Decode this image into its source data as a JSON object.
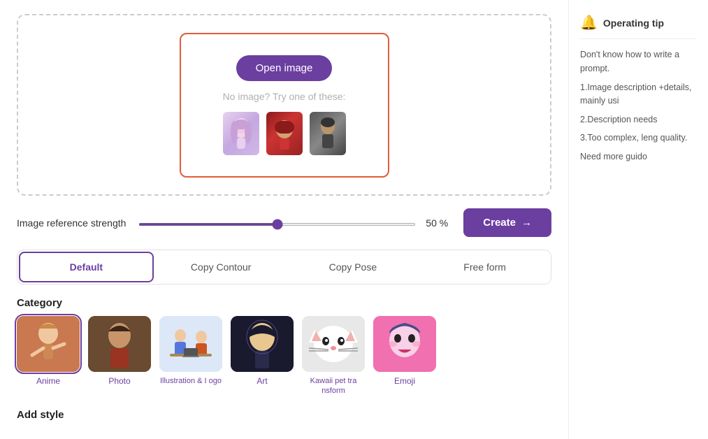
{
  "upload": {
    "open_image_label": "Open image",
    "no_image_text": "No image? Try one of these:"
  },
  "reference_strength": {
    "label": "Image reference strength",
    "value": 50,
    "percent_label": "50 %"
  },
  "create_button": {
    "label": "Create",
    "arrow": "→"
  },
  "tabs": [
    {
      "id": "default",
      "label": "Default",
      "active": true
    },
    {
      "id": "copy-contour",
      "label": "Copy Contour",
      "active": false
    },
    {
      "id": "copy-pose",
      "label": "Copy Pose",
      "active": false
    },
    {
      "id": "free-form",
      "label": "Free form",
      "active": false
    }
  ],
  "category": {
    "label": "Category",
    "items": [
      {
        "id": "anime",
        "name": "Anime",
        "selected": true
      },
      {
        "id": "photo",
        "name": "Photo",
        "selected": false
      },
      {
        "id": "illustration",
        "name": "Illustration & I ogo",
        "selected": false
      },
      {
        "id": "art",
        "name": "Art",
        "selected": false
      },
      {
        "id": "kawaii",
        "name": "Kawaii pet tra nsform",
        "selected": false
      },
      {
        "id": "emoji",
        "name": "Emoji",
        "selected": false
      }
    ]
  },
  "add_style": {
    "label": "Add style"
  },
  "sidebar": {
    "title": "Operating tip",
    "tips": [
      "Don't know how to write a prompt.",
      "1.Image description +details, mainly usi",
      "2.Description needs",
      "3.Too complex, leng quality.",
      "Need more guido"
    ]
  },
  "sample_images": [
    {
      "id": "anime-girl",
      "label": "anime girl sample"
    },
    {
      "id": "red-hood",
      "label": "red hood sample"
    },
    {
      "id": "person",
      "label": "person sample"
    }
  ]
}
